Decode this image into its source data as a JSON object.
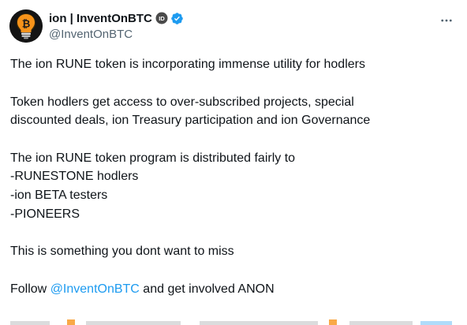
{
  "author": {
    "display_name": "ion | InventOnBTC",
    "handle": "@InventOnBTC",
    "badge_text": "ID",
    "verified": true,
    "avatar_icon": "bitcoin-lightbulb-icon"
  },
  "menu": {
    "more_icon": "more-horizontal-icon"
  },
  "tweet": {
    "line1": "The ion RUNE token is incorporating immense utility for hodlers",
    "line2": "Token hodlers get access to over-subscribed projects, special",
    "line3": "discounted deals, ion Treasury participation and ion Governance",
    "line4": "The ion RUNE token program is distributed fairly to",
    "line5": "-RUNESTONE hodlers",
    "line6": "-ion BETA testers",
    "line7": "-PIONEERS",
    "line8": "This is something you dont want to miss",
    "line9_prefix": "Follow ",
    "line9_mention": "@InventOnBTC",
    "line9_suffix": " and get involved ANON"
  },
  "colors": {
    "text": "#0f1419",
    "secondary": "#536471",
    "link": "#1d9bf0",
    "verified": "#1d9bf0"
  }
}
